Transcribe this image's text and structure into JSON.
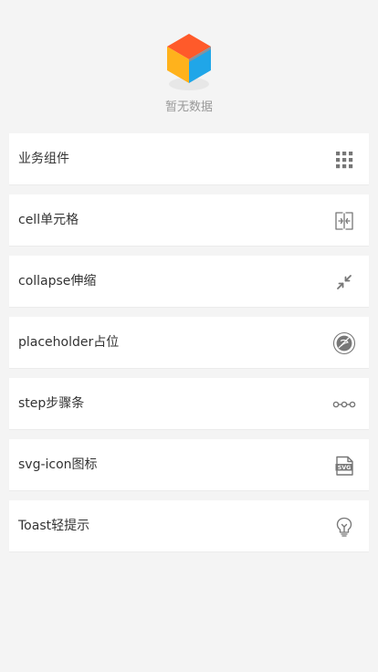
{
  "empty_state": {
    "message": "暂无数据",
    "logo_icon": "empty-cube-icon",
    "logo_colors": [
      "#ff5a2a",
      "#ffb21c",
      "#20a6e8"
    ]
  },
  "menu": {
    "items": [
      {
        "label": "业务组件",
        "icon": "grid-icon"
      },
      {
        "label": "cell单元格",
        "icon": "cell-icon"
      },
      {
        "label": "collapse伸缩",
        "icon": "collapse-icon"
      },
      {
        "label": "placeholder占位",
        "icon": "placeholder-icon"
      },
      {
        "label": "step步骤条",
        "icon": "steps-icon"
      },
      {
        "label": "svg-icon图标",
        "icon": "svg-file-icon"
      },
      {
        "label": "Toast轻提示",
        "icon": "bulb-icon"
      }
    ]
  },
  "colors": {
    "background": "#f4f4f4",
    "card": "#ffffff",
    "text": "#333333",
    "muted_text": "#999999",
    "icon": "#777777"
  }
}
